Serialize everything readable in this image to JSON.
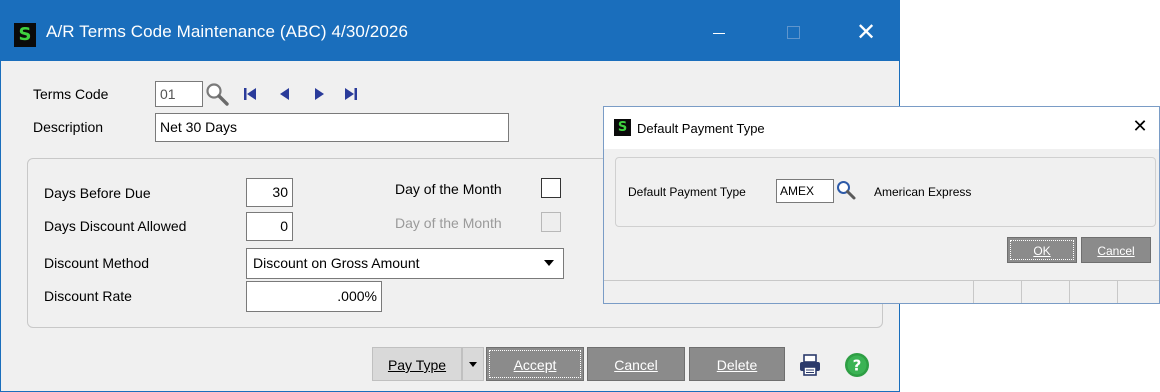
{
  "main_window": {
    "title": "A/R Terms Code Maintenance (ABC) 4/30/2026",
    "logo_text": "S",
    "close_glyph": "✕",
    "header": {
      "terms_code_label": "Terms Code",
      "terms_code_value": "01",
      "description_label": "Description",
      "description_value": "Net 30 Days"
    },
    "details": {
      "days_before_due_label": "Days Before Due",
      "days_before_due_value": "30",
      "days_discount_allowed_label": "Days Discount Allowed",
      "days_discount_allowed_value": "0",
      "discount_method_label": "Discount Method",
      "discount_method_value": "Discount on Gross Amount",
      "discount_rate_label": "Discount Rate",
      "discount_rate_value": ".000%",
      "day_of_month_label_1": "Day of the Month",
      "day_of_month_label_2": "Day of the Month",
      "day_of_month_checked_1": false,
      "day_of_month_checked_2": false
    },
    "buttons": {
      "pay_type_label": "Pay Type",
      "accept_label": "Accept",
      "cancel_label": "Cancel",
      "delete_label": "Delete"
    }
  },
  "dialog": {
    "title": "Default Payment Type",
    "logo_text": "S",
    "close_glyph": "✕",
    "payment_type_label": "Default Payment Type",
    "payment_type_value": "AMEX",
    "payment_type_description": "American Express",
    "ok_label": "OK",
    "cancel_label": "Cancel"
  },
  "colors": {
    "title_bar": "#1a6ebc",
    "logo_green": "#3fd23f",
    "button_gray": "#8b8b8b",
    "help_green": "#2e9e44"
  },
  "icons": {
    "lookup": "magnifier-icon",
    "first": "first-record-icon",
    "prev": "previous-record-icon",
    "next": "next-record-icon",
    "last": "last-record-icon",
    "print": "printer-icon",
    "help": "help-icon"
  }
}
